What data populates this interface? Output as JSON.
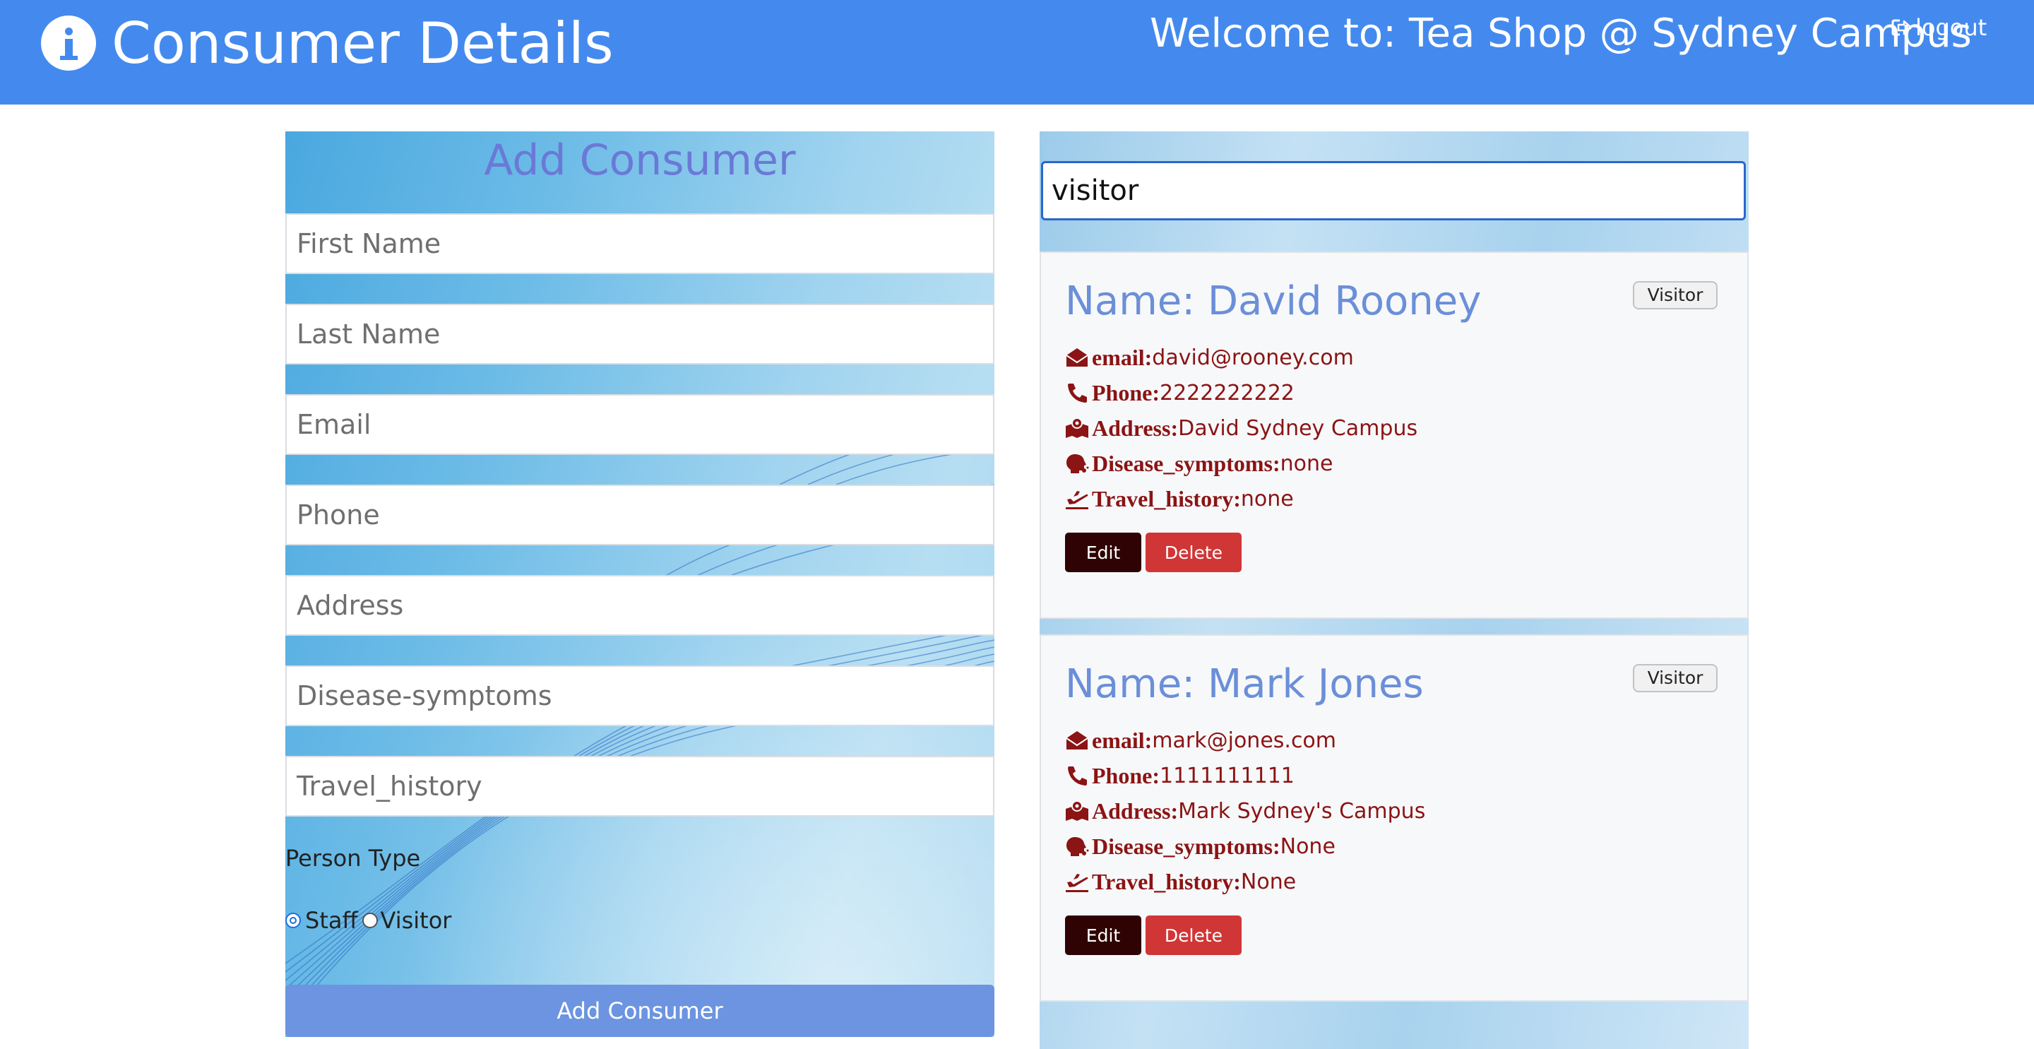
{
  "header": {
    "title": "Consumer Details",
    "welcome": "Welcome to: Tea Shop @ Sydney Campus",
    "logout_label": "logout",
    "background_color": "#448aee"
  },
  "form": {
    "title": "Add Consumer",
    "fields": {
      "first_name": {
        "placeholder": "First Name",
        "value": ""
      },
      "last_name": {
        "placeholder": "Last Name",
        "value": ""
      },
      "email": {
        "placeholder": "Email",
        "value": ""
      },
      "phone": {
        "placeholder": "Phone",
        "value": ""
      },
      "address": {
        "placeholder": "Address",
        "value": ""
      },
      "disease_symptoms": {
        "placeholder": "Disease-symptoms",
        "value": ""
      },
      "travel_history": {
        "placeholder": "Travel_history",
        "value": ""
      }
    },
    "person_type_label": "Person Type",
    "options": {
      "staff": "Staff",
      "visitor": "Visitor"
    },
    "selected_option": "Staff",
    "submit_label": "Add Consumer"
  },
  "search": {
    "value": "visitor"
  },
  "consumers": [
    {
      "name": "Name: David Rooney",
      "type": "Visitor",
      "email_key": "email:",
      "email": "david@rooney.com",
      "phone_key": "Phone:",
      "phone": "2222222222",
      "address_key": "Address:",
      "address": "David Sydney Campus",
      "disease_key": "Disease_symptoms:",
      "disease": "none",
      "travel_key": "Travel_history:",
      "travel": "none",
      "edit_label": "Edit",
      "delete_label": "Delete"
    },
    {
      "name": "Name: Mark Jones",
      "type": "Visitor",
      "email_key": "email:",
      "email": "mark@jones.com",
      "phone_key": "Phone:",
      "phone": "1111111111",
      "address_key": "Address:",
      "address": "Mark Sydney's Campus",
      "disease_key": "Disease_symptoms:",
      "disease": "None",
      "travel_key": "Travel_history:",
      "travel": "None",
      "edit_label": "Edit",
      "delete_label": "Delete"
    }
  ],
  "icons": {
    "header": "info-circle-icon",
    "logout": "sign-out-icon",
    "email": "envelope-open-icon",
    "phone": "phone-icon",
    "address": "map-marked-icon",
    "disease": "head-virus-icon",
    "travel": "plane-departure-icon"
  },
  "colors": {
    "header": "#448aee",
    "label_text": "#8b1414",
    "name_text": "#6b8fd8",
    "edit_button": "#2f0303",
    "delete_button": "#d03636",
    "add_button": "#6c94e0"
  }
}
